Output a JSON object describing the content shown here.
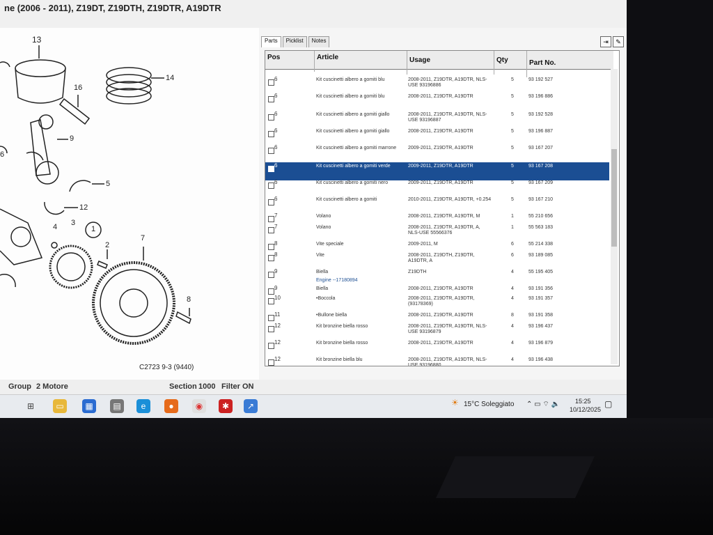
{
  "window": {
    "title": "ne    (2006 - 2011), Z19DT, Z19DTH, Z19DTR, A19DTR"
  },
  "diagram": {
    "callouts": [
      "13",
      "14",
      "16",
      "9",
      "5",
      "12",
      "4",
      "3",
      "1",
      "2",
      "7",
      "8",
      "6"
    ],
    "caption": "C2723 9-3 (9440)"
  },
  "tabs": [
    "Parts",
    "Picklist",
    "Notes"
  ],
  "columns": {
    "pos": "Pos",
    "article": "Article",
    "usage": "Usage",
    "qty": "Qty",
    "part": "Part No."
  },
  "rows": [
    {
      "pos": "6",
      "article": "Kit cuscinetti albero a gomiti blu",
      "usage": "2008-2011, Z19DTR, A19DTR, NLS-USE 93196886",
      "qty": "5",
      "part": "93 192 527"
    },
    {
      "pos": "6",
      "article": "Kit cuscinetti albero a gomiti blu",
      "usage": "2008-2011, Z19DTR, A19DTR",
      "qty": "5",
      "part": "93 196 886"
    },
    {
      "pos": "6",
      "article": "Kit cuscinetti albero a gomiti giallo",
      "usage": "2008-2011, Z19DTR, A19DTR, NLS-USE 93196887",
      "qty": "5",
      "part": "93 192 528"
    },
    {
      "pos": "6",
      "article": "Kit cuscinetti albero a gomiti giallo",
      "usage": "2008-2011, Z19DTR, A19DTR",
      "qty": "5",
      "part": "93 196 887"
    },
    {
      "pos": "6",
      "article": "Kit cuscinetti albero a gomiti marrone",
      "usage": "2009-2011, Z19DTR, A19DTR",
      "qty": "5",
      "part": "93 167 207"
    },
    {
      "pos": "6",
      "article": "Kit cuscinetti albero a gomiti verde",
      "usage": "2009-2011, Z19DTR, A19DTR",
      "qty": "5",
      "part": "93 167 208"
    },
    {
      "pos": "6",
      "article": "Kit cuscinetti albero a gomiti nero",
      "usage": "2009-2011, Z19DTR, A19DTR",
      "qty": "5",
      "part": "93 167 209"
    },
    {
      "pos": "6",
      "article": "Kit cuscinetti albero a gomiti",
      "usage": "2010-2011, Z19DTR, A19DTR, +0.254",
      "qty": "5",
      "part": "93 167 210"
    },
    {
      "pos": "7",
      "article": "Volano",
      "usage": "2008-2011, Z19DTR, A19DTR, M",
      "qty": "1",
      "part": "55 210 656"
    },
    {
      "pos": "7",
      "article": "Volano",
      "usage": "2008-2011, Z19DTR, A19DTR, A, NLS-USE 55566376",
      "qty": "1",
      "part": "55 563 183"
    },
    {
      "pos": "8",
      "article": "Vite speciale",
      "usage": "2009-2011, M",
      "qty": "6",
      "part": "55 214 338"
    },
    {
      "pos": "8",
      "article": "Vite",
      "usage": "2008-2011, Z19DTH, Z19DTR, A19DTR, A",
      "qty": "6",
      "part": "93 189 085"
    },
    {
      "pos": "9",
      "article": "Biella",
      "article2": "Engine --17180894",
      "usage": "Z19DTH",
      "qty": "4",
      "part": "55 195 405"
    },
    {
      "pos": "9",
      "article": "Biella",
      "usage": "2008-2011, Z19DTR, A19DTR",
      "qty": "4",
      "part": "93 191 356"
    },
    {
      "pos": "10",
      "article": "•Boccola",
      "usage": "2008-2011, Z19DTR, A19DTR, (93178369)",
      "qty": "4",
      "part": "93 191 357"
    },
    {
      "pos": "11",
      "article": "•Bullone biella",
      "usage": "2008-2011, Z19DTR, A19DTR",
      "qty": "8",
      "part": "93 191 358"
    },
    {
      "pos": "12",
      "article": "Kit bronzine biella rosso",
      "usage": "2008-2011, Z19DTR, A19DTR, NLS-USE 93196879",
      "qty": "4",
      "part": "93 196 437"
    },
    {
      "pos": "12",
      "article": "Kit bronzine biella rosso",
      "usage": "2008-2011, Z19DTR, A19DTR",
      "qty": "4",
      "part": "93 196 879"
    },
    {
      "pos": "12",
      "article": "Kit bronzine biella blu",
      "usage": "2008-2011, Z19DTR, A19DTR, NLS-USE 93196880",
      "qty": "4",
      "part": "93 196 438"
    }
  ],
  "selected_row": 5,
  "status": {
    "group_label": "Group",
    "group_value": "2 Motore",
    "section_label": "Section",
    "section_value": "1000",
    "filter_label": "Filter",
    "filter_value": "ON"
  },
  "tray": {
    "weather": "15°C Soleggiato",
    "time": "15:25",
    "date": "10/12/2025"
  },
  "colors": {
    "selection": "#1b4e93",
    "screen_bg": "#f3f3f3"
  }
}
